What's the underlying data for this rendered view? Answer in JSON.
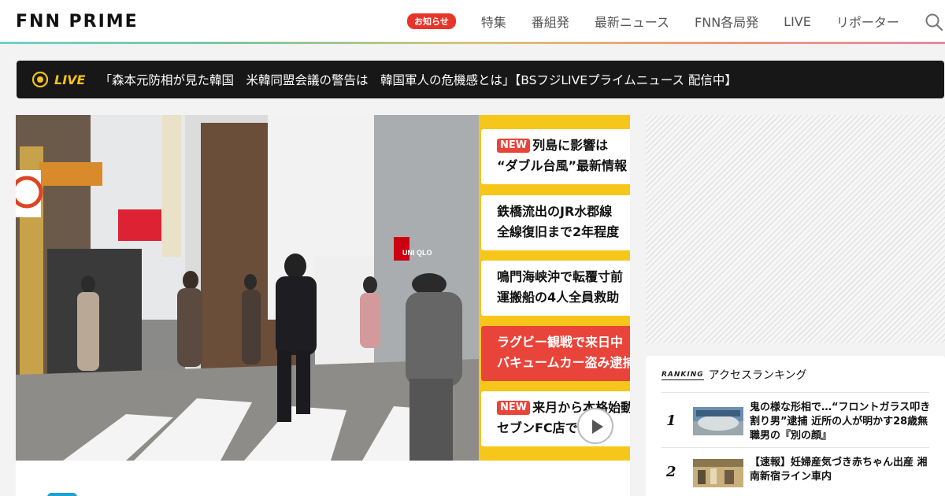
{
  "header": {
    "logo": "FNN PRIME",
    "notice_badge": "お知らせ",
    "nav": [
      "特集",
      "番組発",
      "最新ニュース",
      "FNN各局発",
      "LIVE",
      "リポーター"
    ]
  },
  "live": {
    "label": "LIVE",
    "text": "「森本元防相が見た韓国　米韓同盟会議の警告は　韓国軍人の危機感とは」【BSフジLIVEプライムニュース 配信中】"
  },
  "hero": {
    "headlines": [
      {
        "new": "NEW",
        "line1": "列島に影響は",
        "line2": "“ダブル台風”最新情報"
      },
      {
        "line1": "鉄橋流出のJR水郡線",
        "line2": "全線復旧まで2年程度"
      },
      {
        "line1": "鳴門海峡沖で転覆寸前",
        "line2": "運搬船の4人全員救助"
      },
      {
        "line1": "ラグビー観戦で来日中",
        "line2": "バキュームカー盗み逮捕"
      },
      {
        "new": "NEW",
        "line1": "来月から本格始動",
        "line2": "セブンFC店で“"
      }
    ],
    "sign_uniqlo": "UNI QLO"
  },
  "ranking": {
    "tag": "RANKING",
    "title": "アクセスランキング",
    "items": [
      {
        "rank": "1",
        "title": "鬼の様な形相で…“フロントガラス叩き割り男”逮捕 近所の人が明かす28歳無職男の『別の顔』"
      },
      {
        "rank": "2",
        "title": "【速報】妊婦産気づき赤ちゃん出産 湘南新宿ライン車内"
      }
    ]
  },
  "colors": {
    "accent_red": "#e8352a",
    "live_yellow": "#f5c21a",
    "panel_yellow": "#f7c61a"
  }
}
